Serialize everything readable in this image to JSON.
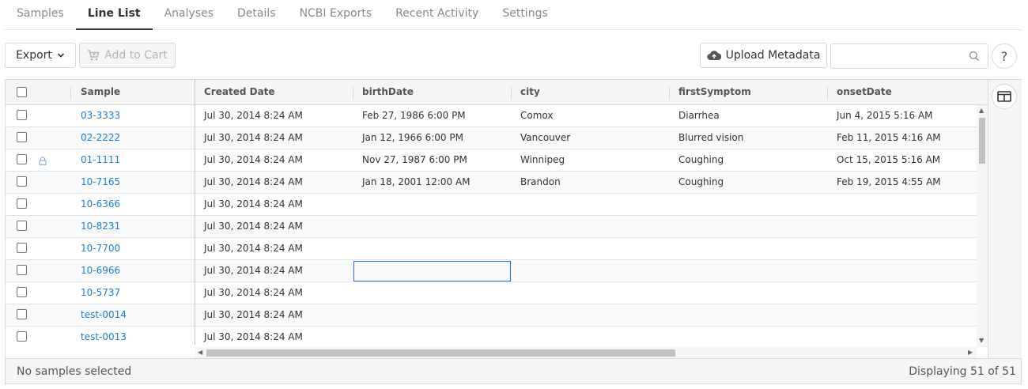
{
  "tabs": [
    {
      "label": "Samples",
      "active": false
    },
    {
      "label": "Line List",
      "active": true
    },
    {
      "label": "Analyses",
      "active": false
    },
    {
      "label": "Details",
      "active": false
    },
    {
      "label": "NCBI Exports",
      "active": false
    },
    {
      "label": "Recent Activity",
      "active": false
    },
    {
      "label": "Settings",
      "active": false
    }
  ],
  "toolbar": {
    "export_label": "Export",
    "add_to_cart_label": "Add to Cart",
    "upload_metadata_label": "Upload Metadata",
    "search_placeholder": "",
    "search_value": "",
    "help_label": "?"
  },
  "grid": {
    "columns": [
      "Sample",
      "Created Date",
      "birthDate",
      "city",
      "firstSymptom",
      "onsetDate"
    ],
    "rows": [
      {
        "sample": "03-3333",
        "created": "Jul 30, 2014 8:24 AM",
        "birthDate": "Feb 27, 1986 6:00 PM",
        "city": "Comox",
        "firstSymptom": "Diarrhea",
        "onsetDate": "Jun 4, 2015 5:16 AM",
        "locked": false
      },
      {
        "sample": "02-2222",
        "created": "Jul 30, 2014 8:24 AM",
        "birthDate": "Jan 12, 1966 6:00 PM",
        "city": "Vancouver",
        "firstSymptom": "Blurred vision",
        "onsetDate": "Feb 11, 2015 4:16 AM",
        "locked": false
      },
      {
        "sample": "01-1111",
        "created": "Jul 30, 2014 8:24 AM",
        "birthDate": "Nov 27, 1987 6:00 PM",
        "city": "Winnipeg",
        "firstSymptom": "Coughing",
        "onsetDate": "Oct 15, 2015 5:16 AM",
        "locked": true
      },
      {
        "sample": "10-7165",
        "created": "Jul 30, 2014 8:24 AM",
        "birthDate": "Jan 18, 2001 12:00 AM",
        "city": "Brandon",
        "firstSymptom": "Coughing",
        "onsetDate": "Feb 19, 2015 4:55 AM",
        "locked": false
      },
      {
        "sample": "10-6366",
        "created": "Jul 30, 2014 8:24 AM",
        "birthDate": "",
        "city": "",
        "firstSymptom": "",
        "onsetDate": "",
        "locked": false
      },
      {
        "sample": "10-8231",
        "created": "Jul 30, 2014 8:24 AM",
        "birthDate": "",
        "city": "",
        "firstSymptom": "",
        "onsetDate": "",
        "locked": false
      },
      {
        "sample": "10-7700",
        "created": "Jul 30, 2014 8:24 AM",
        "birthDate": "",
        "city": "",
        "firstSymptom": "",
        "onsetDate": "",
        "locked": false
      },
      {
        "sample": "10-6966",
        "created": "Jul 30, 2014 8:24 AM",
        "birthDate": "",
        "city": "",
        "firstSymptom": "",
        "onsetDate": "",
        "locked": false
      },
      {
        "sample": "10-5737",
        "created": "Jul 30, 2014 8:24 AM",
        "birthDate": "",
        "city": "",
        "firstSymptom": "",
        "onsetDate": "",
        "locked": false
      },
      {
        "sample": "test-0014",
        "created": "Jul 30, 2014 8:24 AM",
        "birthDate": "",
        "city": "",
        "firstSymptom": "",
        "onsetDate": "",
        "locked": false
      },
      {
        "sample": "test-0013",
        "created": "Jul 30, 2014 8:24 AM",
        "birthDate": "",
        "city": "",
        "firstSymptom": "",
        "onsetDate": "",
        "locked": false
      }
    ]
  },
  "footer": {
    "selection_status": "No samples selected",
    "display_count": "Displaying 51 of 51"
  },
  "colors": {
    "link": "#1f7ecf",
    "focus_border": "#2f6fd0",
    "header_bg": "#f5f5f5"
  }
}
